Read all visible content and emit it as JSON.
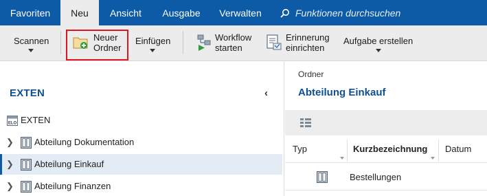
{
  "menu": {
    "tabs": [
      {
        "label": "Favoriten"
      },
      {
        "label": "Neu",
        "active": true
      },
      {
        "label": "Ansicht"
      },
      {
        "label": "Ausgabe"
      },
      {
        "label": "Verwalten"
      }
    ],
    "search_placeholder": "Funktionen durchsuchen"
  },
  "ribbon": {
    "scannen": "Scannen",
    "neuer_ordner_line1": "Neuer",
    "neuer_ordner_line2": "Ordner",
    "einfuegen": "Einfügen",
    "workflow_line1": "Workflow",
    "workflow_line2": "starten",
    "erinnerung_line1": "Erinnerung",
    "erinnerung_line2": "einrichten",
    "aufgabe": "Aufgabe erstellen"
  },
  "left_panel": {
    "title": "EXTEN",
    "collapse_glyph": "‹",
    "tree": [
      {
        "label": "EXTEN",
        "icon": "elo-repository-icon"
      },
      {
        "label": "Abteilung Dokumentation",
        "icon": "cabinet-icon"
      },
      {
        "label": "Abteilung Einkauf",
        "icon": "cabinet-icon",
        "selected": true
      },
      {
        "label": "Abteilung Finanzen",
        "icon": "cabinet-icon"
      }
    ],
    "elo_badge": "ELO"
  },
  "right_panel": {
    "breadcrumb": "Ordner",
    "title": "Abteilung Einkauf",
    "columns": [
      "Typ",
      "Kurzbezeichnung",
      "Datum"
    ],
    "rows": [
      {
        "typ_icon": "cabinet-icon",
        "kurzbezeichnung": "Bestellungen"
      }
    ]
  },
  "colors": {
    "menubar": "#0d5aa7",
    "ribbon": "#ececec",
    "title_blue": "#0d4f8f",
    "highlight_red": "#e0141e",
    "selected_row": "#e3ecf5"
  }
}
